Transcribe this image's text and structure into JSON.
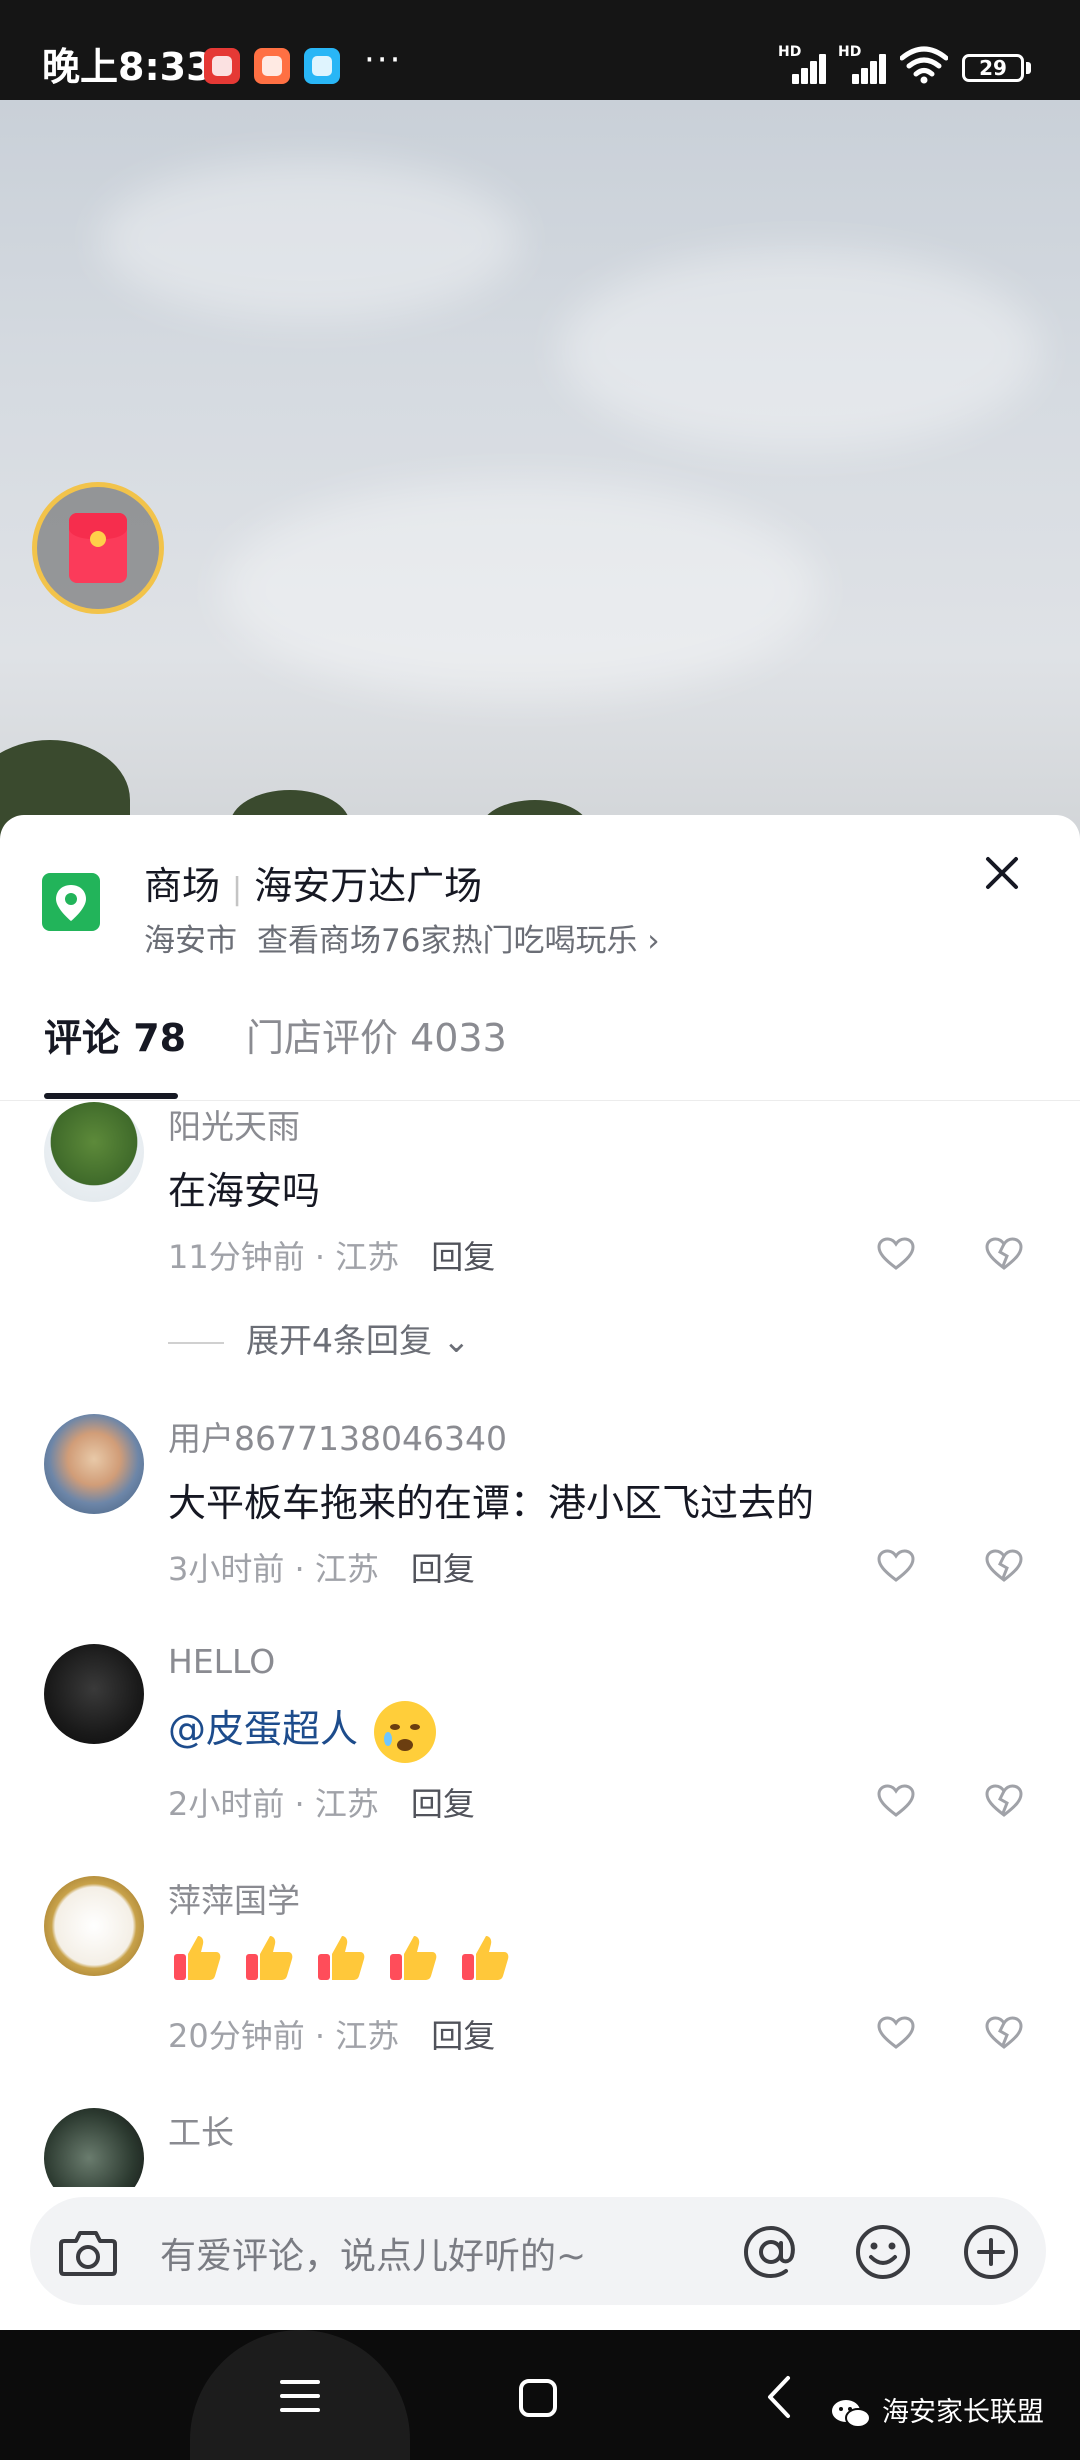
{
  "status_bar": {
    "time": "晚上8:33",
    "more": "···",
    "network_1": "HD",
    "network_2": "HD",
    "battery": "29"
  },
  "location": {
    "category": "商场",
    "name": "海安万达广场",
    "city": "海安市",
    "link": "查看商场76家热门吃喝玩乐 ›"
  },
  "tabs": [
    {
      "label": "评论 78",
      "active": true
    },
    {
      "label": "门店评价 4033",
      "active": false
    }
  ],
  "comments": [
    {
      "user": "阳光天雨",
      "text": "在海安吗",
      "time": "11分钟前",
      "region": "江苏",
      "reply": "回复",
      "expand": "展开4条回复"
    },
    {
      "user": "用户8677138046340",
      "text": "大平板车拖来的在谭：港小区飞过去的",
      "time": "3小时前",
      "region": "江苏",
      "reply": "回复"
    },
    {
      "user": "HELLO",
      "text": "@皮蛋超人",
      "time": "2小时前",
      "region": "江苏",
      "reply": "回复"
    },
    {
      "user": "萍萍国学",
      "text": "",
      "time": "20分钟前",
      "region": "江苏",
      "reply": "回复"
    },
    {
      "user": "工长"
    }
  ],
  "input": {
    "placeholder": "有爱评论，说点儿好听的~"
  },
  "watermark": "海安家长联盟",
  "colors": {
    "accent_green": "#22b45a",
    "mention_blue": "#1d4c8c",
    "redpacket": "#fb3b5a"
  }
}
